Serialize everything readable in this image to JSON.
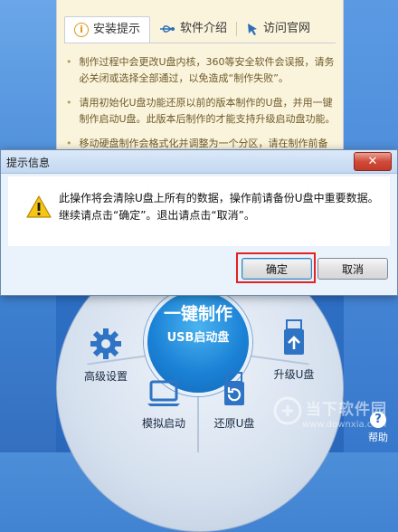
{
  "info_panel": {
    "tabs": [
      {
        "label": "安装提示",
        "icon": "info-icon"
      },
      {
        "label": "软件介绍",
        "icon": "usb-icon"
      },
      {
        "label": "访问官网",
        "icon": "pointer-icon"
      }
    ],
    "notes": [
      "制作过程中会更改U盘内核，360等安全软件会误报，请务必关闭或选择全部通过，以免造成“制作失败”。",
      "请用初始化U盘功能还原以前的版本制作的U盘，并用一键制作启动U盘。此版本后制作的才能支持升级启动盘功能。",
      "移动硬盘制作会格式化并调整为一个分区，请在制作前备份"
    ]
  },
  "dialog": {
    "title": "提示信息",
    "close_label": "✕",
    "icon": "warning-icon",
    "message": "此操作将会清除U盘上所有的数据，操作前请备份U盘中重要数据。继续请点击“确定”。退出请点击“取消”。",
    "ok_label": "确定",
    "cancel_label": "取消",
    "highlight_color": "#e32222"
  },
  "main_menu": {
    "center_main": "一键制作",
    "center_sub": "USB启动盘",
    "items": [
      {
        "label": "高级设置",
        "icon": "gear-icon"
      },
      {
        "label": "模拟启动",
        "icon": "monitor-icon"
      },
      {
        "label": "还原U盘",
        "icon": "usb-restore-icon"
      },
      {
        "label": "升级U盘",
        "icon": "usb-upgrade-icon"
      }
    ],
    "help_label": "帮助"
  },
  "watermark": {
    "text": "当下软件园",
    "url": "www.downxia.com"
  }
}
